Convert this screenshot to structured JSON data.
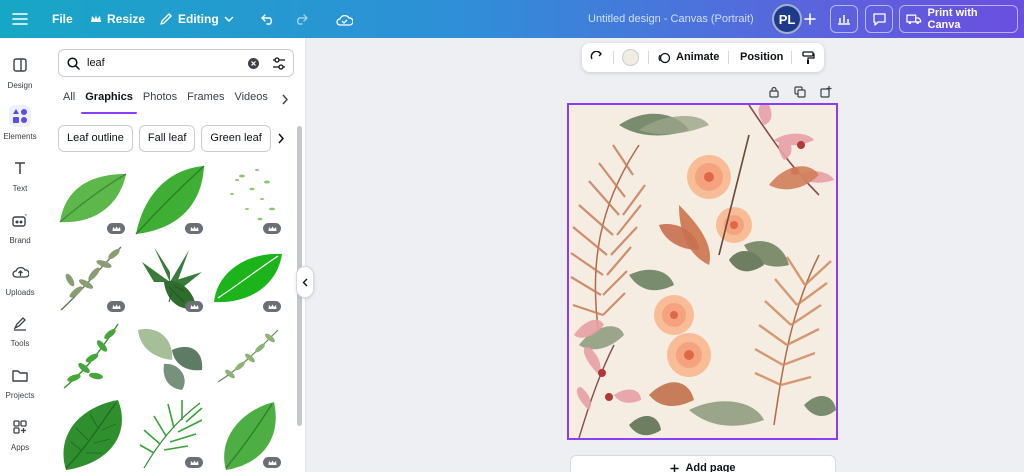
{
  "topbar": {
    "file_label": "File",
    "resize_label": "Resize",
    "editing_label": "Editing",
    "doc_title": "Untitled design - Canvas (Portrait)",
    "avatar_initials": "PL",
    "print_label": "Print with Canva"
  },
  "rail": {
    "items": [
      {
        "label": "Design",
        "icon": "design-icon"
      },
      {
        "label": "Elements",
        "icon": "elements-icon"
      },
      {
        "label": "Text",
        "icon": "text-icon"
      },
      {
        "label": "Brand",
        "icon": "brand-icon"
      },
      {
        "label": "Uploads",
        "icon": "uploads-icon"
      },
      {
        "label": "Tools",
        "icon": "tools-icon"
      },
      {
        "label": "Projects",
        "icon": "projects-icon"
      },
      {
        "label": "Apps",
        "icon": "apps-icon"
      }
    ],
    "active": "Elements"
  },
  "panel": {
    "search_value": "leaf",
    "tabs": [
      "All",
      "Graphics",
      "Photos",
      "Frames",
      "Videos"
    ],
    "active_tab": "Graphics",
    "chips": [
      "Leaf outline",
      "Fall leaf",
      "Green leaf"
    ]
  },
  "context_toolbar": {
    "animate_label": "Animate",
    "position_label": "Position",
    "swatch_color": "#f1ece0"
  },
  "canvas": {
    "add_page_label": "Add page"
  },
  "colors": {
    "accent": "#8b3dff",
    "topbar_start": "#17a7c6",
    "topbar_end": "#6a4fe0"
  }
}
